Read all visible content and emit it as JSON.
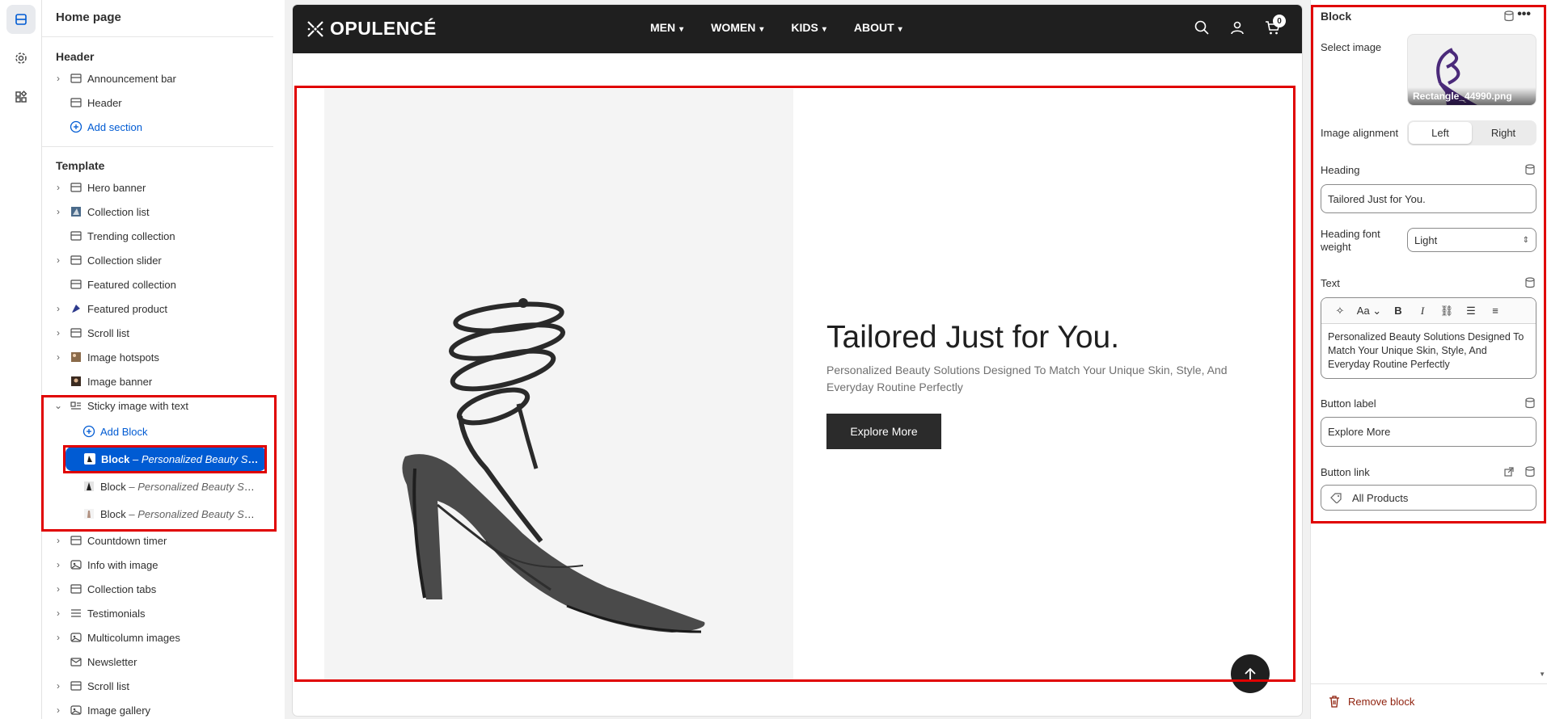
{
  "sidebar": {
    "title": "Home page",
    "header_label": "Header",
    "header_items": [
      "Announcement bar",
      "Header"
    ],
    "add_section": "Add section",
    "template_label": "Template",
    "template_items": [
      "Hero banner",
      "Collection list",
      "Trending collection",
      "Collection slider",
      "Featured collection",
      "Featured product",
      "Scroll list",
      "Image hotspots",
      "Image banner",
      "Sticky image with text"
    ],
    "add_block": "Add Block",
    "blocks": [
      {
        "prefix": "Block",
        "suffix": " – Personalized Beauty Sol..."
      },
      {
        "prefix": "Block",
        "suffix": " – Personalized Beauty Sol..."
      },
      {
        "prefix": "Block",
        "suffix": " – Personalized Beauty Sol..."
      }
    ],
    "after_items": [
      "Countdown timer",
      "Info with image",
      "Collection tabs",
      "Testimonials",
      "Multicolumn images",
      "Newsletter",
      "Scroll list",
      "Image gallery"
    ]
  },
  "store": {
    "logo": "OPULENCÉ",
    "nav": [
      "MEN",
      "WOMEN",
      "KIDS",
      "ABOUT"
    ],
    "cart_count": "0"
  },
  "hero": {
    "heading": "Tailored Just for You.",
    "text": "Personalized Beauty Solutions Designed To Match Your Unique Skin, Style, And Everyday Routine Perfectly",
    "button": "Explore More"
  },
  "panel": {
    "title": "Block",
    "select_image_label": "Select image",
    "image_filename": "Rectangle_44990.png",
    "alignment_label": "Image alignment",
    "alignment_options": [
      "Left",
      "Right"
    ],
    "alignment_selected": "Left",
    "heading_label": "Heading",
    "heading_value": "Tailored Just for You.",
    "weight_label": "Heading font weight",
    "weight_value": "Light",
    "text_label": "Text",
    "text_value": "Personalized Beauty Solutions Designed To Match Your Unique Skin, Style, And Everyday Routine Perfectly",
    "button_label_label": "Button label",
    "button_label_value": "Explore More",
    "button_link_label": "Button link",
    "button_link_value": "All Products",
    "remove": "Remove block"
  },
  "colors": {
    "accent": "#005bd3",
    "highlight": "#e00000",
    "store_header": "#1f1f1f"
  }
}
